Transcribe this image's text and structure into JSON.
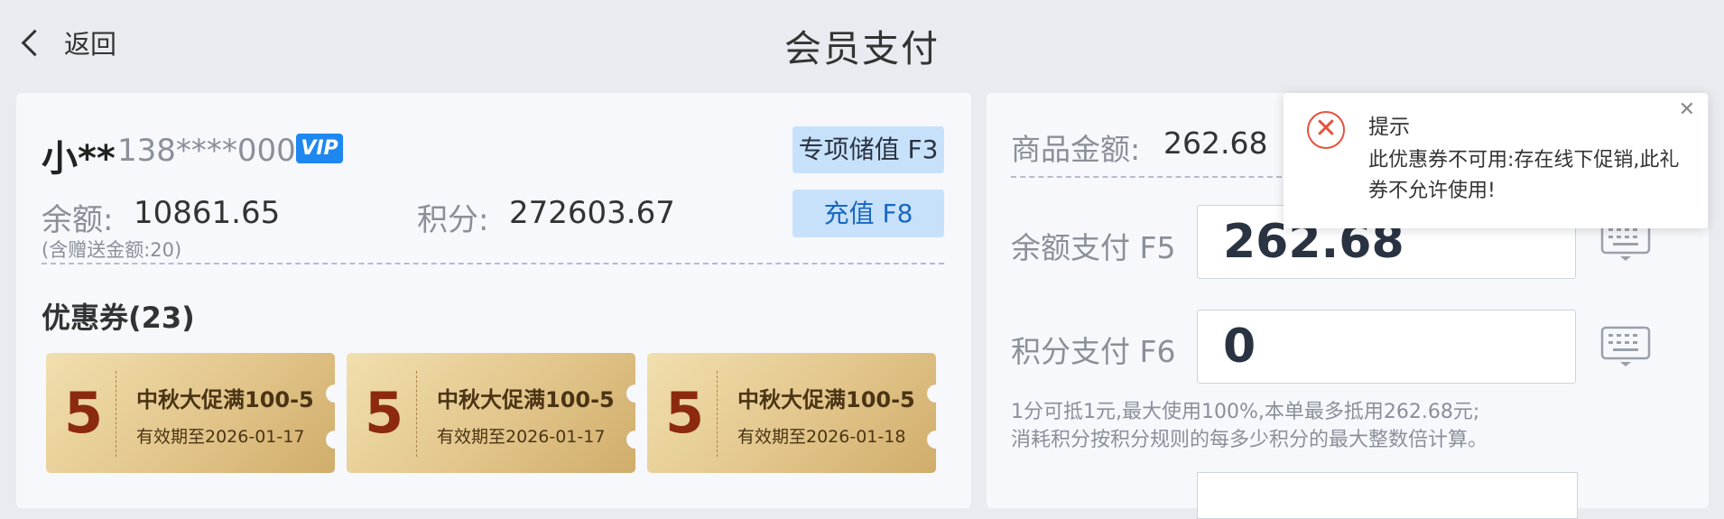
{
  "header": {
    "back_label": "返回",
    "title": "会员支付"
  },
  "member": {
    "name": "小**",
    "phone": "138****0000",
    "vip_badge": "VIP",
    "store_value_button": "专项储值 F3",
    "recharge_button": "充值 F8",
    "balance_label": "余额:",
    "balance_value": "10861.65",
    "gift_note": "(含赠送金额:20)",
    "points_label": "积分:",
    "points_value": "272603.67"
  },
  "coupons": {
    "title": "优惠券(23)",
    "items": [
      {
        "amount": "5",
        "name": "中秋大促满100-5",
        "expiry": "有效期至2026-01-17"
      },
      {
        "amount": "5",
        "name": "中秋大促满100-5",
        "expiry": "有效期至2026-01-17"
      },
      {
        "amount": "5",
        "name": "中秋大促满100-5",
        "expiry": "有效期至2026-01-18"
      }
    ]
  },
  "payment": {
    "goods_label": "商品金额:",
    "goods_value": "262.68",
    "balance_pay_label": "余额支付 F5",
    "balance_pay_value": "262.68",
    "points_pay_label": "积分支付 F6",
    "points_pay_value": "0",
    "hint_line1": "1分可抵1元,最大使用100%,本单最多抵用262.68元;",
    "hint_line2": "消耗积分按积分规则的每多少积分的最大整数倍计算。"
  },
  "toast": {
    "title": "提示",
    "message": "此优惠券不可用:存在线下促销,此礼券不允许使用!",
    "close_icon": "close-icon",
    "status_icon": "error-circle-icon"
  },
  "colors": {
    "accent": "#1e88f0",
    "button_bg": "#c7e1fa",
    "error": "#e8503a",
    "coupon_amount": "#8b2a0f"
  }
}
